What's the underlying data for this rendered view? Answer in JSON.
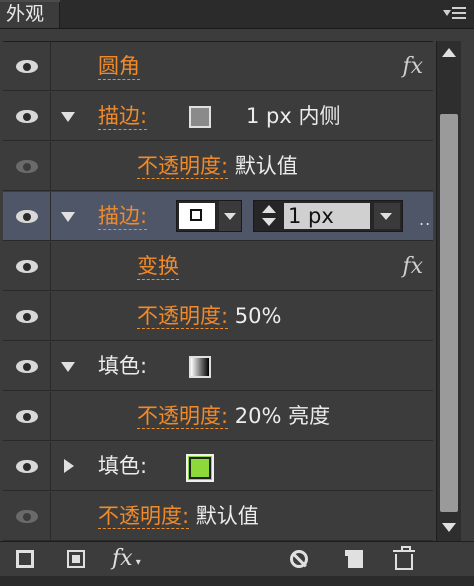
{
  "tab": {
    "label": "外观"
  },
  "rows": [
    {
      "type": "item",
      "label": "圆角",
      "fx": "fx"
    },
    {
      "type": "stroke",
      "label": "描边:",
      "value": "1 px  内侧"
    },
    {
      "type": "opacity",
      "label": "不透明度:",
      "value": "默认值"
    },
    {
      "type": "stroke-edit",
      "label": "描边:",
      "weight": "1 px",
      "more": ".."
    },
    {
      "type": "effect",
      "label": "变换",
      "fx": "fx"
    },
    {
      "type": "opacity",
      "label": "不透明度:",
      "value": "50%"
    },
    {
      "type": "fill",
      "label": "填色:"
    },
    {
      "type": "opacity",
      "label": "不透明度:",
      "value": "20% 亮度"
    },
    {
      "type": "fill",
      "label": "填色:"
    },
    {
      "type": "opacity",
      "label": "不透明度:",
      "value": "默认值"
    }
  ],
  "footer": {
    "fx_label": "fx"
  },
  "colors": {
    "accent_link": "#f08a2a",
    "selected_row": "#4f5668",
    "fill_green": "#8ed93a"
  },
  "icons": [
    "eye-icon",
    "fx-icon",
    "panel-menu-icon",
    "new-stroke-icon",
    "new-fill-icon",
    "clear-icon",
    "duplicate-icon",
    "delete-icon"
  ]
}
